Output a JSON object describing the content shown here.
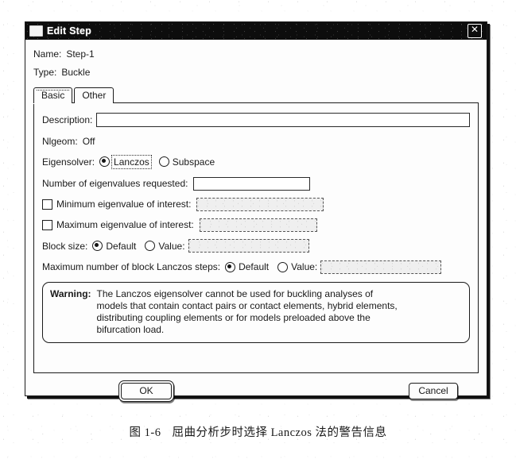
{
  "window": {
    "title": "Edit Step",
    "icon": "window-icon",
    "close_label": "✕"
  },
  "fields": {
    "name_label": "Name:",
    "name_value": "Step-1",
    "type_label": "Type:",
    "type_value": "Buckle"
  },
  "tabs": [
    {
      "label": "Basic",
      "active": true
    },
    {
      "label": "Other",
      "active": false
    }
  ],
  "basic": {
    "description_label": "Description:",
    "description_value": "",
    "nlgeom_label": "Nlgeom:",
    "nlgeom_value": "Off",
    "eigensolver_label": "Eigensolver:",
    "eigensolver_options": [
      {
        "label": "Lanczos",
        "selected": true,
        "focused": true
      },
      {
        "label": "Subspace",
        "selected": false,
        "focused": false
      }
    ],
    "num_eigen_label": "Number of eigenvalues requested:",
    "num_eigen_value": "",
    "min_eigen_label": "Minimum eigenvalue of interest:",
    "min_eigen_checked": false,
    "min_eigen_value": "",
    "max_eigen_label": "Maximum eigenvalue of interest:",
    "max_eigen_checked": false,
    "max_eigen_value": "",
    "block_size_label": "Block size:",
    "block_size_default": "Default",
    "block_size_value_label": "Value:",
    "block_size_value": "",
    "max_steps_label": "Maximum number of block Lanczos steps:",
    "max_steps_default": "Default",
    "max_steps_value_label": "Value:",
    "max_steps_value": ""
  },
  "warning": {
    "title": "Warning:",
    "text": "The Lanczos eigensolver cannot be used for buckling analyses of models that contain contact pairs or contact elements, hybrid elements, distributing coupling elements or for models preloaded above the bifurcation load."
  },
  "buttons": {
    "ok": "OK",
    "cancel": "Cancel"
  },
  "caption": {
    "number": "图 1-6",
    "text": "屈曲分析步时选择 Lanczos 法的警告信息"
  }
}
